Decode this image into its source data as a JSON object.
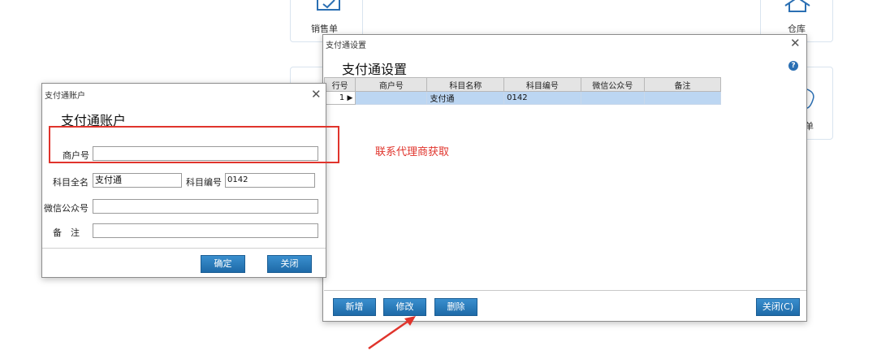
{
  "background": {
    "tile_sales_label": "销售单",
    "tile_warehouse_label": "仓库",
    "tile_partial_label": "单"
  },
  "settings_window": {
    "title": "支付通设置",
    "heading": "支付通设置",
    "columns": [
      "行号",
      "商户号",
      "科目名称",
      "科目编号",
      "微信公众号",
      "备注"
    ],
    "rows": [
      {
        "row_no": "1",
        "marker": "▶",
        "merchant_no": "",
        "account_name": "支付通",
        "account_code": "0142",
        "wechat": "",
        "remark": ""
      }
    ],
    "buttons": {
      "add": "新增",
      "edit": "修改",
      "delete": "删除",
      "close": "关闭(C)"
    }
  },
  "account_dialog": {
    "title": "支付通账户",
    "heading": "支付通账户",
    "fields": {
      "merchant_no_label": "商户号",
      "merchant_no_value": "",
      "account_full_name_label": "科目全名",
      "account_full_name_value": "支付通",
      "account_code_label": "科目编号",
      "account_code_value": "0142",
      "wechat_label": "微信公众号",
      "wechat_value": "",
      "remark_label": "备　注",
      "remark_value": ""
    },
    "buttons": {
      "ok": "确定",
      "close": "关闭"
    }
  },
  "annotation": {
    "hint_text": "联系代理商获取",
    "highlight_color": "#e0342c"
  },
  "colors": {
    "button_blue": "#2a7bbd",
    "selected_row": "#bcd6f2"
  }
}
